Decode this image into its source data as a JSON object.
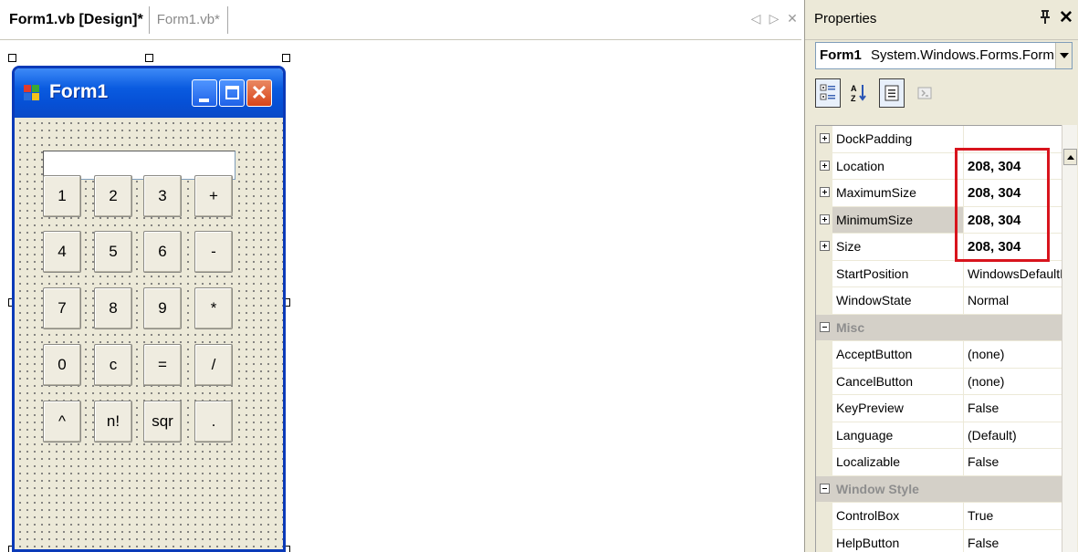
{
  "designer_tabs": {
    "active_tab": "Form1.vb [Design]*",
    "inactive_tab": "Form1.vb*",
    "scroll_left_glyph": "◁",
    "scroll_right_glyph": "▷",
    "close_glyph": "✕"
  },
  "form": {
    "title": "Form1",
    "textbox_value": "",
    "buttons": [
      "1",
      "2",
      "3",
      "+",
      "4",
      "5",
      "6",
      "-",
      "7",
      "8",
      "9",
      "*",
      "0",
      "c",
      "=",
      "/",
      "^",
      "n!",
      "sqr",
      "."
    ],
    "icons": {
      "app": "form-app-icon",
      "minimize": "minimize-icon",
      "maximize": "maximize-icon",
      "close": "close-icon"
    },
    "titlebar_color": "#0a5be0",
    "close_button_color": "#d8451a"
  },
  "properties": {
    "title": "Properties",
    "pin_glyph": "ᵠ",
    "close_glyph": "✕",
    "object_name": "Form1",
    "object_type": "System.Windows.Forms.Form",
    "toolbar_icons": [
      "categorized-icon",
      "alphabetical-icon",
      "properties-icon",
      "events-icon"
    ],
    "rows": [
      {
        "kind": "prop",
        "expander": "plus",
        "name": "DockPadding",
        "value": "",
        "bold": false
      },
      {
        "kind": "prop",
        "expander": "plus",
        "name": "Location",
        "value": "208, 304",
        "bold": true
      },
      {
        "kind": "prop",
        "expander": "plus",
        "name": "MaximumSize",
        "value": "208, 304",
        "bold": true
      },
      {
        "kind": "prop",
        "expander": "plus",
        "name": "MinimumSize",
        "value": "208, 304",
        "bold": true,
        "selected": true
      },
      {
        "kind": "prop",
        "expander": "plus",
        "name": "Size",
        "value": "208, 304",
        "bold": true
      },
      {
        "kind": "prop",
        "expander": "",
        "name": "StartPosition",
        "value": "WindowsDefaultLocation",
        "bold": false
      },
      {
        "kind": "prop",
        "expander": "",
        "name": "WindowState",
        "value": "Normal",
        "bold": false
      },
      {
        "kind": "category",
        "expander": "minus",
        "name": "Misc"
      },
      {
        "kind": "prop",
        "expander": "",
        "name": "AcceptButton",
        "value": "(none)",
        "bold": false
      },
      {
        "kind": "prop",
        "expander": "",
        "name": "CancelButton",
        "value": "(none)",
        "bold": false
      },
      {
        "kind": "prop",
        "expander": "",
        "name": "KeyPreview",
        "value": "False",
        "bold": false
      },
      {
        "kind": "prop",
        "expander": "",
        "name": "Language",
        "value": "(Default)",
        "bold": false
      },
      {
        "kind": "prop",
        "expander": "",
        "name": "Localizable",
        "value": "False",
        "bold": false
      },
      {
        "kind": "category",
        "expander": "minus",
        "name": "Window Style"
      },
      {
        "kind": "prop",
        "expander": "",
        "name": "ControlBox",
        "value": "True",
        "bold": false
      },
      {
        "kind": "prop",
        "expander": "",
        "name": "HelpButton",
        "value": "False",
        "bold": false
      }
    ],
    "highlight_color": "#d8141d"
  }
}
